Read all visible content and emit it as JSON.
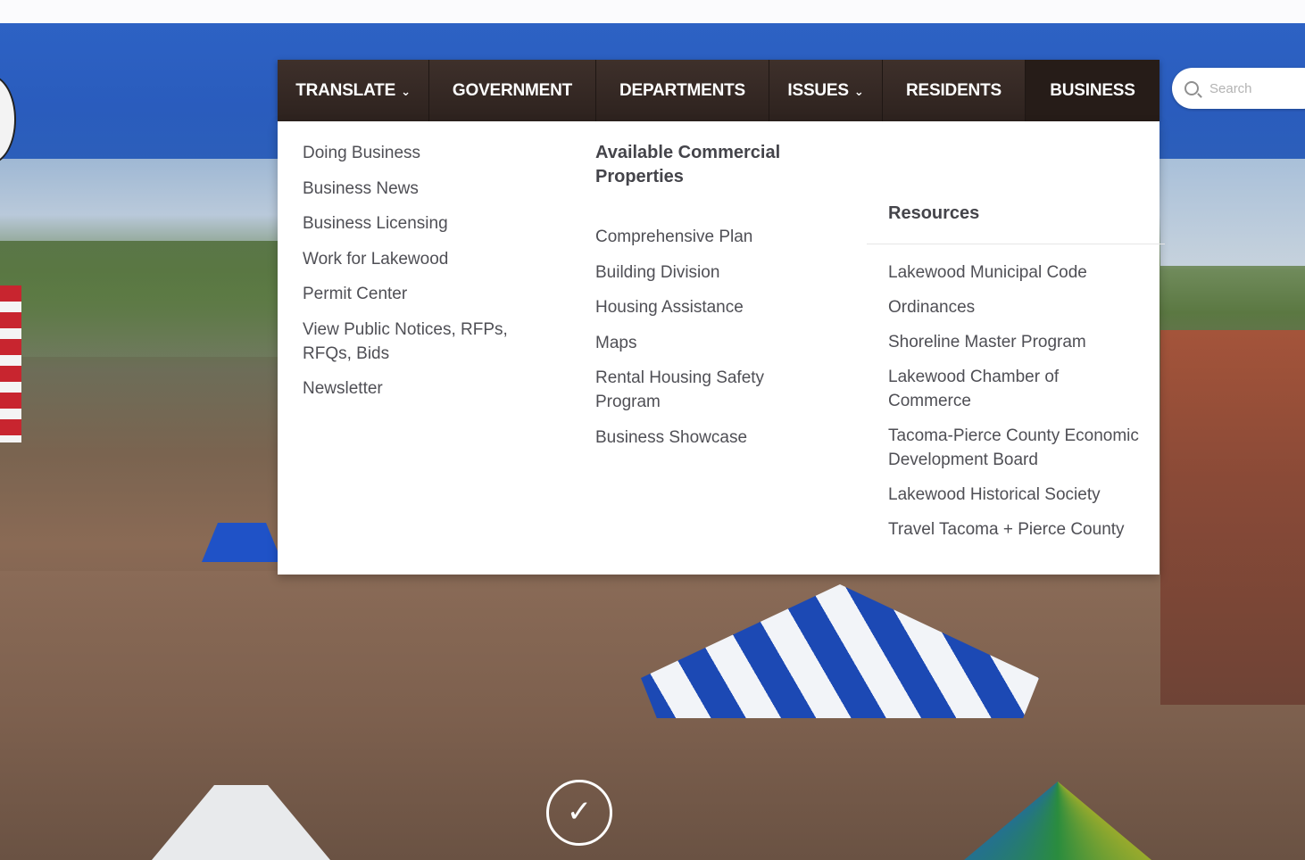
{
  "nav": {
    "items": [
      {
        "label": "TRANSLATE",
        "has_dropdown": true
      },
      {
        "label": "GOVERNMENT",
        "has_dropdown": false
      },
      {
        "label": "DEPARTMENTS",
        "has_dropdown": false
      },
      {
        "label": "ISSUES",
        "has_dropdown": true
      },
      {
        "label": "RESIDENTS",
        "has_dropdown": false
      },
      {
        "label": "BUSINESS",
        "has_dropdown": false,
        "active": true
      }
    ],
    "dropdown_icon": "chevron-down-icon"
  },
  "search": {
    "placeholder": "Search",
    "icon": "search-icon"
  },
  "business_menu": {
    "col1": {
      "links": [
        "Doing Business",
        "Business News",
        "Business Licensing",
        "Work for Lakewood",
        "Permit Center",
        "View Public Notices, RFPs, RFQs, Bids",
        "Newsletter"
      ]
    },
    "col2": {
      "heading": "Available Commercial Properties",
      "links": [
        "Comprehensive Plan",
        "Building Division",
        "Housing Assistance",
        "Maps",
        "Rental Housing Safety Program",
        "Business Showcase"
      ]
    },
    "col3": {
      "heading": "Resources",
      "links": [
        "Lakewood Municipal Code",
        "Ordinances",
        "Shoreline Master Program",
        "Lakewood Chamber of Commerce",
        "Tacoma-Pierce County Economic Development Board",
        "Lakewood Historical Society",
        "Travel Tacoma + Pierce County"
      ]
    }
  },
  "hero": {
    "scroll_icon": "chevron-down-circle-icon",
    "scroll_glyph": "✓"
  },
  "colors": {
    "header_blue": "#2d62c4",
    "nav_brown": "#2d221e",
    "menu_text": "#4f4f55"
  }
}
